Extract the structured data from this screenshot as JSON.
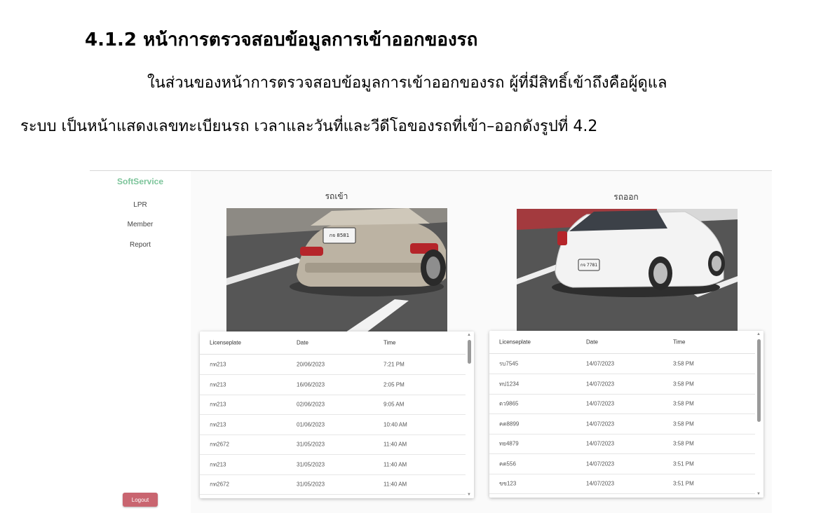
{
  "document": {
    "heading": "4.1.2 หน้าการตรวจสอบข้อมูลการเข้าออกของรถ",
    "paragraph_line1": "ในส่วนของหน้าการตรวจสอบข้อมูลการเข้าออกของรถ ผู้ที่มีสิทธิ์เข้าถึงคือผู้ดูแล",
    "paragraph_line2": "ระบบ เป็นหน้าแสดงเลขทะเบียนรถ เวลาและวันที่และวีดีโอของรถที่เข้า–ออกดังรูปที่ 4.2"
  },
  "app": {
    "brand": "SoftService",
    "nav": [
      {
        "label": "LPR"
      },
      {
        "label": "Member"
      },
      {
        "label": "Report"
      }
    ],
    "logout_label": "Logout"
  },
  "entry_panel": {
    "title": "รถเข้า",
    "plate_text": "กจ 8581",
    "headers": [
      "Licenseplate",
      "Date",
      "Time"
    ],
    "rows": [
      [
        "กท213",
        "20/06/2023",
        "7:21 PM"
      ],
      [
        "กท213",
        "16/06/2023",
        "2:05 PM"
      ],
      [
        "กท213",
        "02/06/2023",
        "9:05 AM"
      ],
      [
        "กท213",
        "01/06/2023",
        "10:40 AM"
      ],
      [
        "กท2672",
        "31/05/2023",
        "11:40 AM"
      ],
      [
        "กท213",
        "31/05/2023",
        "11:40 AM"
      ],
      [
        "กท2672",
        "31/05/2023",
        "11:40 AM"
      ]
    ]
  },
  "exit_panel": {
    "title": "รถออก",
    "plate_text": "กจ 7781",
    "headers": [
      "Licenseplate",
      "Date",
      "Time"
    ],
    "rows": [
      [
        "รบ7545",
        "14/07/2023",
        "3:58 PM"
      ],
      [
        "ทป1234",
        "14/07/2023",
        "3:58 PM"
      ],
      [
        "ดว9865",
        "14/07/2023",
        "3:58 PM"
      ],
      [
        "คต8899",
        "14/07/2023",
        "3:58 PM"
      ],
      [
        "ทย4879",
        "14/07/2023",
        "3:58 PM"
      ],
      [
        "คต556",
        "14/07/2023",
        "3:51 PM"
      ],
      [
        "ขข123",
        "14/07/2023",
        "3:51 PM"
      ]
    ]
  },
  "colors": {
    "brand": "#7cc49a",
    "logout": "#c96570"
  }
}
